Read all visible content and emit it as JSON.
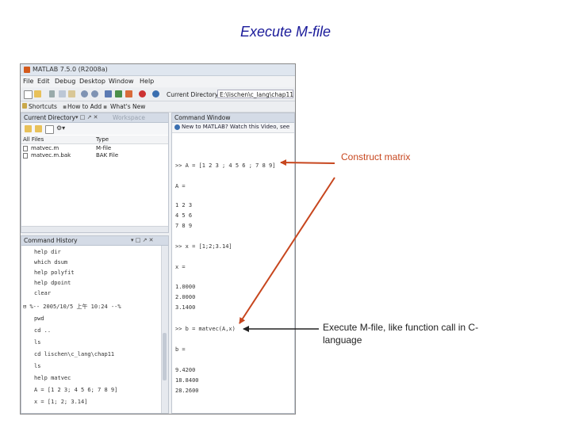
{
  "slide": {
    "title": "Execute M-file",
    "annotations": [
      "Construct matrix",
      "Execute M-file, like function call in C-language"
    ]
  },
  "matlab": {
    "window_title": "MATLAB 7.5.0 (R2008a)",
    "menu": [
      "File",
      "Edit",
      "Debug",
      "Desktop",
      "Window",
      "Help"
    ],
    "current_directory_label": "Current Directory:",
    "current_directory_value": "E:\\lischen\\c_lang\\chap11",
    "shortcuts": [
      "Shortcuts",
      "How to Add",
      "What's New"
    ],
    "current_directory_panel": {
      "title": "Current Directory",
      "inactive_tab": "Workspace",
      "columns": [
        "All Files",
        "Type"
      ],
      "files": [
        {
          "name": "matvec.m",
          "type": "M-file"
        },
        {
          "name": "matvec.m.bak",
          "type": "BAK File"
        }
      ]
    },
    "command_history": {
      "title": "Command History",
      "lines": [
        "help dir",
        "which dsum",
        "help polyfit",
        "help dpoint",
        "clear",
        "%-- 2005/10/5 上午 10:24 --%",
        "pwd",
        "cd ..",
        "ls",
        "cd lischen\\c_lang\\chap11",
        "ls",
        "help matvec",
        "A = [1 2 3; 4 5 6; 7 8 9]",
        "x = [1; 2; 3.14]"
      ]
    },
    "command_window": {
      "title": "Command Window",
      "banner": "New to MATLAB? Watch this Video, see",
      "lines": [
        ">> A = [1 2 3 ; 4 5 6 ; 7 8 9]",
        "A =",
        "     1     2     3",
        "     4     5     6",
        "     7     8     9",
        ">> x = [1;2;3.14]",
        "x =",
        "    1.0000",
        "    2.0000",
        "    3.1400",
        ">> b = matvec(A,x)",
        "b =",
        "    9.4200",
        "   18.8400",
        "   28.2600"
      ]
    }
  }
}
